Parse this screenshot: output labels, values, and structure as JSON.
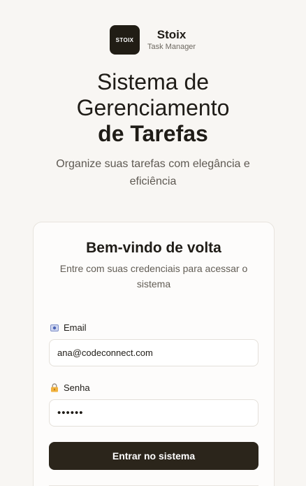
{
  "brand": {
    "logo_text": "STOIX",
    "name": "Stoix",
    "subtitle": "Task Manager"
  },
  "hero": {
    "line1": "Sistema de",
    "line2": "Gerenciamento",
    "line3": "de Tarefas",
    "description": "Organize suas tarefas com elegância e eficiência"
  },
  "login": {
    "title": "Bem-vindo de volta",
    "subtitle": "Entre com suas credenciais para acessar o sistema",
    "email": {
      "label": "Email",
      "icon": "email-icon",
      "value": "ana@codeconnect.com"
    },
    "password": {
      "label": "Senha",
      "icon": "lock-icon",
      "value": "••••••"
    },
    "submit_label": "Entrar no sistema"
  },
  "colors": {
    "background": "#f8f6f3",
    "card": "#fdfcfb",
    "primary": "#2b251b",
    "logo_bg": "#211d15"
  }
}
